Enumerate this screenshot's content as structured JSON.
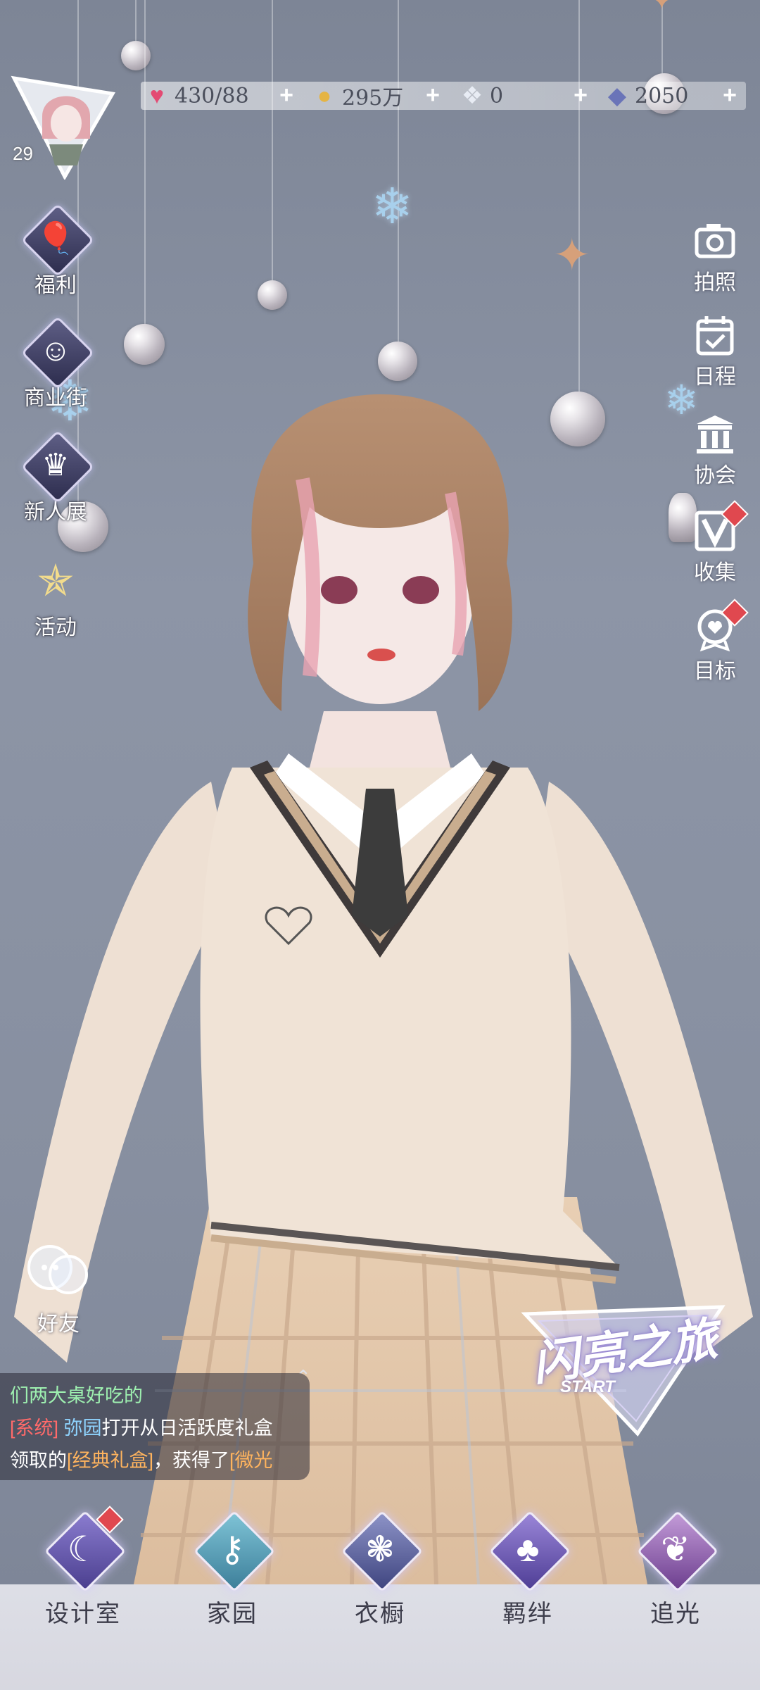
{
  "player": {
    "level": "29"
  },
  "currencies": [
    {
      "icon": "heart-gem-icon",
      "value": "430/88"
    },
    {
      "icon": "gold-coin-icon",
      "value": "295万"
    },
    {
      "icon": "crystal-flower-icon",
      "value": "0"
    },
    {
      "icon": "diamond-icon",
      "value": "2050"
    }
  ],
  "left_menu": [
    {
      "icon": "hot-air-balloon-icon",
      "label": "福利"
    },
    {
      "icon": "shopping-bag-icon",
      "label": "商业街"
    },
    {
      "icon": "crown-trophy-icon",
      "label": "新人展"
    },
    {
      "icon": "stars-icon",
      "label": "活动"
    }
  ],
  "right_menu": [
    {
      "icon": "camera-icon",
      "label": "拍照"
    },
    {
      "icon": "calendar-check-icon",
      "label": "日程"
    },
    {
      "icon": "guild-building-icon",
      "label": "协会"
    },
    {
      "icon": "collection-v-icon",
      "label": "收集"
    },
    {
      "icon": "target-medal-icon",
      "label": "目标"
    }
  ],
  "friends": {
    "label": "好友"
  },
  "chat": {
    "line1": "们两大桌好吃的",
    "line2_tag": "[系统]",
    "line2_name": "弥园",
    "line2_text": "打开从日活跃度礼盒",
    "line3_a": "领取的",
    "line3_item": "[经典礼盒]",
    "line3_b": "，获得了",
    "line3_reward": "[微光"
  },
  "start_logo": {
    "title": "闪亮之旅",
    "sub": "START"
  },
  "bottom_nav": [
    {
      "icon": "moon-icon",
      "label": "设计室"
    },
    {
      "icon": "key-icon",
      "label": "家园"
    },
    {
      "icon": "crystal-icon",
      "label": "衣橱"
    },
    {
      "icon": "clover-icon",
      "label": "羁绊"
    },
    {
      "icon": "butterfly-icon",
      "label": "追光"
    }
  ],
  "colors": {
    "background": "#878fa0",
    "badge_red": "#e0484f",
    "chat_system": "#ff6a6a",
    "chat_name": "#8fd4ff",
    "chat_item": "#ffb45e"
  }
}
